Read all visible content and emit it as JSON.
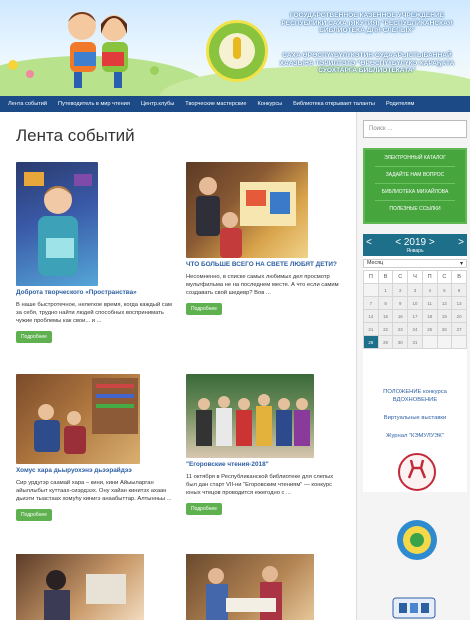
{
  "banner": {
    "line1": "ГОСУДАРСТВЕННОЕ КАЗЕННОЕ УЧРЕЖДЕНИЕ РЕСПУБЛИКИ САХА (ЯКУТИЯ) \"РЕСПУБЛИКАНСКАЯ БИБЛИОТЕКА ДЛЯ СЛЕПЫХ\"",
    "line2": "САХА ӨРӨСПҮҮБҮЛҮКЭТИН СУДААРЫСТЫБАННАЙ ХААЗЫНА ТЭРИЛТЭТЭ \"ӨРӨСПҮҮБҮЛҮКЭ ХАРАҔАТА СУОХТАРГА БИБЛИОТЕКАТА\""
  },
  "nav": {
    "items": [
      "Лента событий",
      "Путеводитель в мир чтения",
      "Центр.клубы",
      "Творческие мастерские",
      "Конкурсы",
      "Библиотека открывает таланты",
      "Родителям"
    ]
  },
  "main": {
    "title": "Лента событий",
    "button_label": "Подробнее",
    "cards": [
      {
        "title": "Доброта творческого «Пространства»",
        "text": "В наше быстротечное, нелегкое время, когда каждый сам за себя, трудно найти людей способных воспринимать чужие проблемы как свои... и ..."
      },
      {
        "title": "ЧТО БОЛЬШЕ ВСЕГО НА СВЕТЕ ЛЮБЯТ ДЕТИ?",
        "text": "Несомненно, в списке самых любимых дел просмотр мультфильма не на последнем месте. А что если самим создавать свой шедевр? Вов ..."
      },
      {
        "title": "Хомус хара дьыруохэнэ дьээрайдээ",
        "text": "Сир урдугэр саамай хара – кини, кини Айыыларган айыллыбыт куттаах-сиэрдээх. Ону хайан кинитэх ахаан дьиэти тыастаах хомуһу кинигэ анаабыттар. Алтынньы ..."
      },
      {
        "title": "\"Егоровские чтения-2018\"",
        "text": "11 октября в Республиканской библиотеке для слепых был дан старт VII-ни \"Егоровским чтениям\" — конкурс юных чтецов проводится ежегодно с ..."
      }
    ]
  },
  "sidebar": {
    "search_placeholder": "Поиск ...",
    "green_links": [
      "ЭЛЕКТРОННЫЙ КАТАЛОГ",
      "ЗАДАЙТЕ НАМ ВОПРОС",
      "БИБЛИОТЕКА МИХАЙЛОВА",
      "ПОЛЕЗНЫЕ ССЫЛКИ"
    ],
    "calendar": {
      "prev": "<",
      "next": ">",
      "year_label": "< 2019 >",
      "month_label": "Январь",
      "select_value": "Месяц",
      "days": [
        "П",
        "В",
        "С",
        "Ч",
        "П",
        "С",
        "В"
      ],
      "rows": [
        [
          "",
          "1",
          "2",
          "3",
          "4",
          "5",
          "6"
        ],
        [
          "7",
          "8",
          "9",
          "10",
          "11",
          "12",
          "13"
        ],
        [
          "14",
          "15",
          "16",
          "17",
          "18",
          "19",
          "20"
        ],
        [
          "21",
          "22",
          "23",
          "24",
          "25",
          "26",
          "27"
        ],
        [
          "28",
          "29",
          "30",
          "31",
          "",
          "",
          ""
        ]
      ],
      "today": "28"
    },
    "links": [
      "ПОЛОЖЕНИЕ конкурса ВДОХНОВЕНИЕ",
      "Виртуальные выставки",
      "Журнал \"КЭМУЛУЭК\""
    ]
  },
  "colors": {
    "nav_bg": "#1b4a87",
    "green": "#46a63d",
    "calendar_head": "#1e6f8a",
    "link": "#2d5fa3",
    "button": "#5fb04f"
  }
}
